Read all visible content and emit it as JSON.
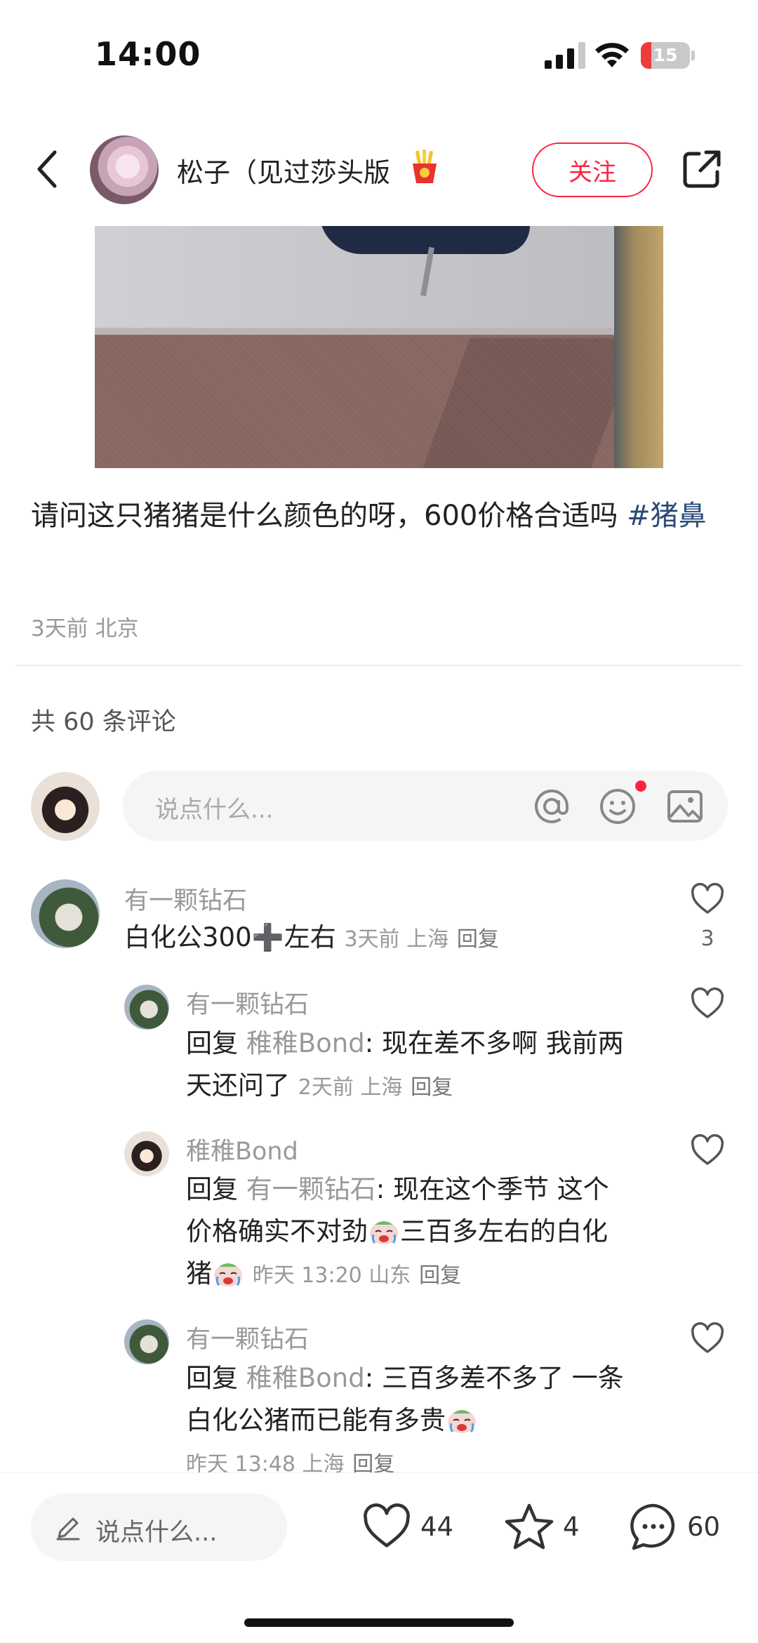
{
  "status_bar": {
    "time": "14:00",
    "battery": "15"
  },
  "header": {
    "author_name": "松子（见过莎头版",
    "follow_label": "关注"
  },
  "post": {
    "text": "请问这只猪猪是什么颜色的呀，600价格合适吗 ",
    "hashtag": "#猪鼻",
    "meta": "3天前 北京"
  },
  "comments_header": {
    "count_label": "共 60 条评论"
  },
  "comment_input": {
    "placeholder": "说点什么..."
  },
  "comments": [
    {
      "name": "有一颗钻石",
      "text": "白化公300➕左右",
      "time_loc": "3天前 上海",
      "reply_label": "回复",
      "likes": "3"
    },
    {
      "name": "有一颗钻石",
      "reply_prefix": "回复",
      "reply_to": "稚稚Bond",
      "text_line1": ": 现在差不多啊 我前两",
      "text_line2": "天还问了",
      "time_loc": "2天前 上海",
      "reply_label": "回复"
    },
    {
      "name": "稚稚Bond",
      "reply_prefix": "回复",
      "reply_to": "有一颗钻石",
      "text_line1": ": 现在这个季节 这个",
      "text_line2a": "价格确实不对劲",
      "text_line2b": "三百多左右的白化",
      "text_line3": "猪",
      "time_loc": "昨天 13:20 山东",
      "reply_label": "回复"
    },
    {
      "name": "有一颗钻石",
      "reply_prefix": "回复",
      "reply_to": "稚稚Bond",
      "text_line1": ": 三百多差不多了 一条",
      "text_line2": "白化公猪而已能有多贵",
      "time_loc": "昨天 13:48 上海",
      "reply_label": "回复"
    }
  ],
  "bottom_bar": {
    "input_placeholder": "说点什么...",
    "likes": "44",
    "collects": "4",
    "comments": "60"
  },
  "colors": {
    "accent": "#ff2442",
    "hashtag": "#2a4a7a",
    "muted": "#999999"
  },
  "icons": [
    "back-icon",
    "share-icon",
    "fries-emoji-icon",
    "at-icon",
    "emoji-icon",
    "image-icon",
    "heart-icon",
    "star-icon",
    "comment-bubble-icon",
    "pen-icon",
    "crying-emoji-icon",
    "signal-icon",
    "wifi-icon",
    "battery-icon"
  ]
}
